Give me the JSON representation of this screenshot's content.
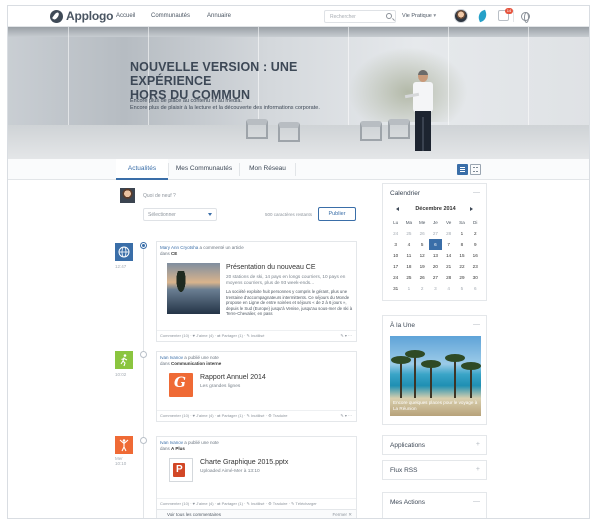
{
  "app": {
    "logo_text": "Applogo"
  },
  "nav": {
    "items": [
      "Accueil",
      "Communautés",
      "Annuaire"
    ]
  },
  "search": {
    "placeholder": "Rechercher"
  },
  "user_menu": {
    "label": "Vie Pratique",
    "notif_count": "14"
  },
  "hero": {
    "title_line1": "NOUVELLE VERSION : UNE EXPÉRIENCE",
    "title_line2": "HORS DU COMMUN",
    "sub_line1": "Encore plus de place au contenu et au media.",
    "sub_line2": "Encore plus de plaisir à la lecture et la découverte des informations corporate."
  },
  "tabs": [
    "Actualités",
    "Mes Communautés",
    "Mon Réseau"
  ],
  "composer": {
    "placeholder": "Quoi de neuf ?",
    "select_value": "Sélectionner",
    "char_count": "500 caractères restants",
    "publish_label": "Publier"
  },
  "posts": [
    {
      "time": "12:47",
      "author": "Mary Ann Cryotsha",
      "action": "a commenté un article",
      "in_label": "dans",
      "in_target": "CE",
      "title": "Présentation du nouveau CE",
      "subtitle": "20 stations de ski, 14 pays en longs courriers, 10 pays en moyens courriers, plus de 93 week-ends...",
      "body": "La société exploite huit personnes y compris le gérant, plus une trentaine d'accompagnateurs intermittents. Ce séjours du Monde propose en Ligne de entre soirées et séjours « de 2 à 6 jours », depuis le Sud (Europe) jusqu'à Venise, jusqu'au sous-mer de ski à Terre-Chevalier, en pass",
      "footer": "Commenter (10) · ♥ J'aime (4) · ⇄ Partager (1) · ✎ Inutilisé",
      "more": "✎ ▾ ⋯"
    },
    {
      "time": "10:02",
      "author": "Ivan Ivanov",
      "action": "a publié une note",
      "in_label": "dans",
      "in_target": "Communication interne",
      "title": "Rapport Annuel 2014",
      "subtitle": "Les grandes lignes",
      "footer": "Commenter (10) · ♥ J'aime (4) · ⇄ Partager (1) · ✎ Inutilisé · ⚙ Traduire",
      "more": "✎ ▾ ⋯"
    },
    {
      "time_line1": "Mer",
      "time_line2": "10:10",
      "author": "Ivan Ivanov",
      "action": "a publié une note",
      "in_label": "dans",
      "in_target": "A Plus",
      "title": "Charte Graphique 2015.pptx",
      "subtitle": "Uploaded Aimé-Mer à 13:10",
      "footer": "Commenter (10) · ♥ J'aime (4) · ⇄ Partager (1) · ✎ Inutilisé · ⚙ Traduire · ✎ Télécharger"
    }
  ],
  "comments_bar": {
    "label": "Voir tous les commentaires",
    "close": "Fermer ✕"
  },
  "calendar": {
    "title": "Calendrier",
    "month": "Décembre 2014",
    "days": [
      "Lu",
      "Ma",
      "Me",
      "Je",
      "Ve",
      "Sa",
      "Di"
    ],
    "cells": [
      "24",
      "25",
      "26",
      "27",
      "28",
      "1",
      "2",
      "3",
      "4",
      "5",
      "6",
      "7",
      "8",
      "9",
      "10",
      "11",
      "12",
      "13",
      "14",
      "15",
      "16",
      "17",
      "18",
      "19",
      "20",
      "21",
      "22",
      "23",
      "24",
      "25",
      "26",
      "27",
      "28",
      "29",
      "30",
      "31",
      "1",
      "2",
      "3",
      "4",
      "5",
      "6"
    ],
    "dim_cells": [
      0,
      1,
      2,
      3,
      4,
      36,
      37,
      38,
      39,
      40,
      41
    ],
    "today_cell": 10
  },
  "une": {
    "title": "À la Une",
    "caption": "Encore quelques places pour le voyage à La Réunion"
  },
  "applications": {
    "title": "Applications"
  },
  "rss": {
    "title": "Flux RSS"
  },
  "actions": {
    "title": "Mes Actions"
  },
  "colors": {
    "accent": "#3a6ea8",
    "orange": "#ef6a35",
    "green": "#8bc53f",
    "blue_icon": "#3a6ea8"
  }
}
